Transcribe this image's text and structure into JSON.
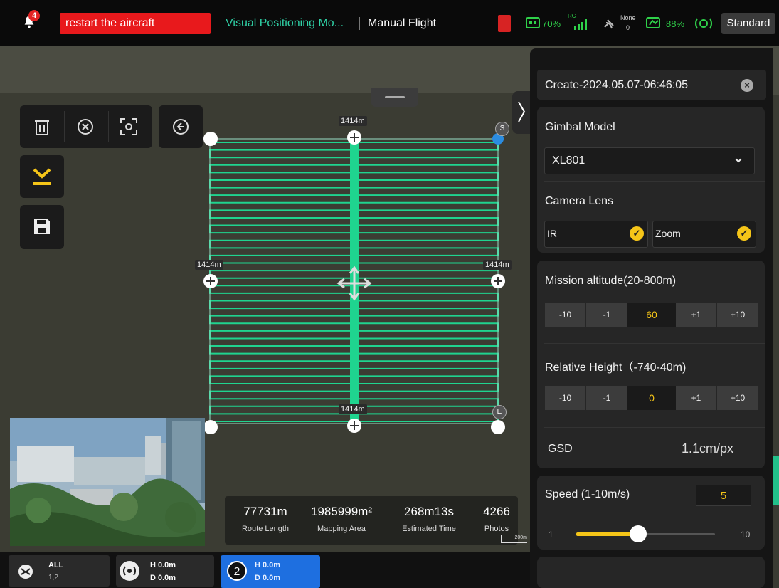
{
  "topbar": {
    "notification_count": "4",
    "alert_text": "restart the aircraft",
    "positioning_mode": "Visual Positioning Mo...",
    "flight_mode": "Manual Flight",
    "rc_battery": "70%",
    "rc_label": "RC",
    "gnss_label": "None",
    "gnss_count": "0",
    "drone_battery": "88%",
    "mode_button": "Standard"
  },
  "route": {
    "top_label": "1414m",
    "left_label": "1414m",
    "right_label": "1414m",
    "bottom_label": "1414m",
    "start_marker": "S",
    "end_marker": "E",
    "line_count": 38
  },
  "stats": {
    "route_length": {
      "value": "77731m",
      "label": "Route Length"
    },
    "mapping_area": {
      "value": "1985999m²",
      "label": "Mapping Area"
    },
    "estimated_time": {
      "value": "268m13s",
      "label": "Estimated Time"
    },
    "photos": {
      "value": "4266",
      "label": "Photos"
    },
    "scale": "200m"
  },
  "bottombar": {
    "all": {
      "label": "ALL",
      "sub": "1,2"
    },
    "drone1": {
      "h": "H 0.0m",
      "d": "D 0.0m"
    },
    "drone2": {
      "num": "2",
      "h": "H 0.0m",
      "d": "D 0.0m"
    }
  },
  "panel": {
    "mission_name": "Create-2024.05.07-06:46:05",
    "gimbal_label": "Gimbal Model",
    "gimbal_value": "XL801",
    "lens_label": "Camera Lens",
    "lens_ir": "IR",
    "lens_zoom": "Zoom",
    "altitude_label": "Mission altitude(20-800m)",
    "altitude_stepper": [
      "-10",
      "-1",
      "60",
      "+1",
      "+10"
    ],
    "relative_label": "Relative Height（-740-40m)",
    "relative_stepper": [
      "-10",
      "-1",
      "0",
      "+1",
      "+10"
    ],
    "gsd_label": "GSD",
    "gsd_value": "1.1cm/px",
    "speed_label": "Speed (1-10m/s)",
    "speed_value": "5",
    "speed_min": "1",
    "speed_max": "10"
  },
  "colors": {
    "accent_green": "#2fd1a6",
    "route_green": "#1fd48f",
    "alert_red": "#e8191c",
    "check_yellow": "#f5c518"
  }
}
